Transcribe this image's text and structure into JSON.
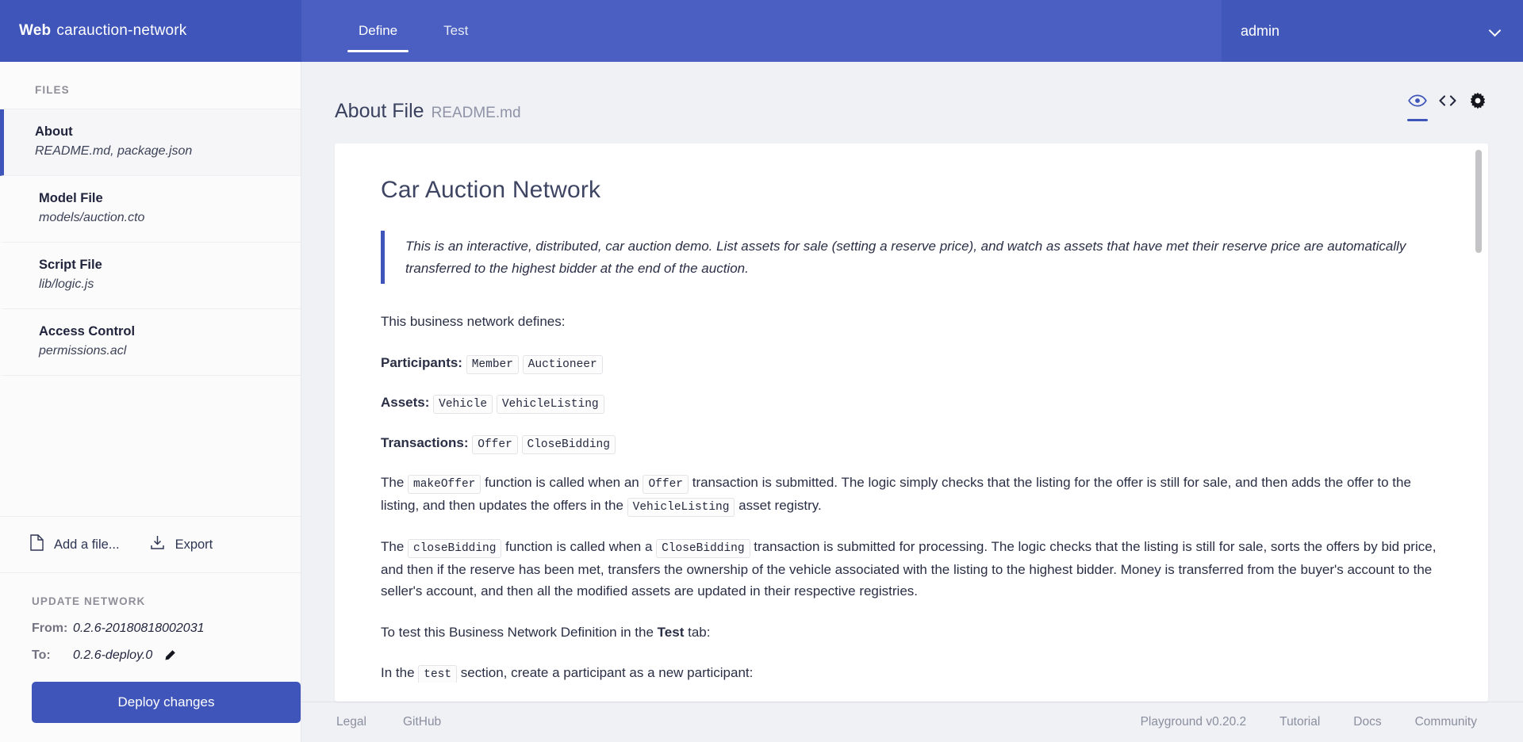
{
  "brand": {
    "prefix": "Web",
    "network": "carauction-network"
  },
  "topnav": {
    "tabs": [
      {
        "label": "Define",
        "active": true
      },
      {
        "label": "Test",
        "active": false
      }
    ]
  },
  "user": {
    "name": "admin",
    "chevron_icon": "chevron-down-icon"
  },
  "sidebar": {
    "files_heading": "FILES",
    "files": [
      {
        "title": "About",
        "sub": "README.md, package.json",
        "active": true
      },
      {
        "title": "Model File",
        "sub": "models/auction.cto",
        "active": false
      },
      {
        "title": "Script File",
        "sub": "lib/logic.js",
        "active": false
      },
      {
        "title": "Access Control",
        "sub": "permissions.acl",
        "active": false
      }
    ],
    "actions": [
      {
        "label": "Add a file...",
        "icon": "file-icon"
      },
      {
        "label": "Export",
        "icon": "download-icon"
      }
    ],
    "update_heading": "UPDATE NETWORK",
    "from_label": "From:",
    "from_value": "0.2.6-20180818002031",
    "to_label": "To:",
    "to_value": "0.2.6-deploy.0",
    "edit_icon": "pencil-icon",
    "deploy_label": "Deploy changes"
  },
  "main": {
    "title": "About File",
    "subtitle": "README.md",
    "view_icons": [
      {
        "name": "eye-icon",
        "active": true
      },
      {
        "name": "code-brackets-icon",
        "active": false
      },
      {
        "name": "gear-icon",
        "active": false
      }
    ]
  },
  "readme": {
    "heading": "Car Auction Network",
    "quote": "This is an interactive, distributed, car auction demo. List assets for sale (setting a reserve price), and watch as assets that have met their reserve price are automatically transferred to the highest bidder at the end of the auction.",
    "defines_intro": "This business network defines:",
    "participants_label": "Participants:",
    "participants": [
      "Member",
      "Auctioneer"
    ],
    "assets_label": "Assets:",
    "assets": [
      "Vehicle",
      "VehicleListing"
    ],
    "transactions_label": "Transactions:",
    "transactions": [
      "Offer",
      "CloseBidding"
    ],
    "para_makeoffer": {
      "t1": "The ",
      "c1": "makeOffer",
      "t2": " function is called when an ",
      "c2": "Offer",
      "t3": " transaction is submitted. The logic simply checks that the listing for the offer is still for sale, and then adds the offer to the listing, and then updates the offers in the ",
      "c3": "VehicleListing",
      "t4": " asset registry."
    },
    "para_closebidding": {
      "t1": "The ",
      "c1": "closeBidding",
      "t2": " function is called when a ",
      "c2": "CloseBidding",
      "t3": " transaction is submitted for processing. The logic checks that the listing is still for sale, sorts the offers by bid price, and then if the reserve has been met, transfers the ownership of the vehicle associated with the listing to the highest bidder. Money is transferred from the buyer's account to the seller's account, and then all the modified assets are updated in their respective registries."
    },
    "para_totest": {
      "t1": "To test this Business Network Definition in the ",
      "b1": "Test",
      "t2": " tab:"
    },
    "cut_line": {
      "t1": "In the ",
      "c1": "test",
      "t2": " section, create a participant as a new participant:"
    }
  },
  "footer": {
    "left": [
      "Legal",
      "GitHub"
    ],
    "right": [
      "Playground v0.20.2",
      "Tutorial",
      "Docs",
      "Community"
    ]
  },
  "colors": {
    "brand": "#3f55b9",
    "topbar": "#4a5fc1",
    "accent": "#3f55b9"
  }
}
